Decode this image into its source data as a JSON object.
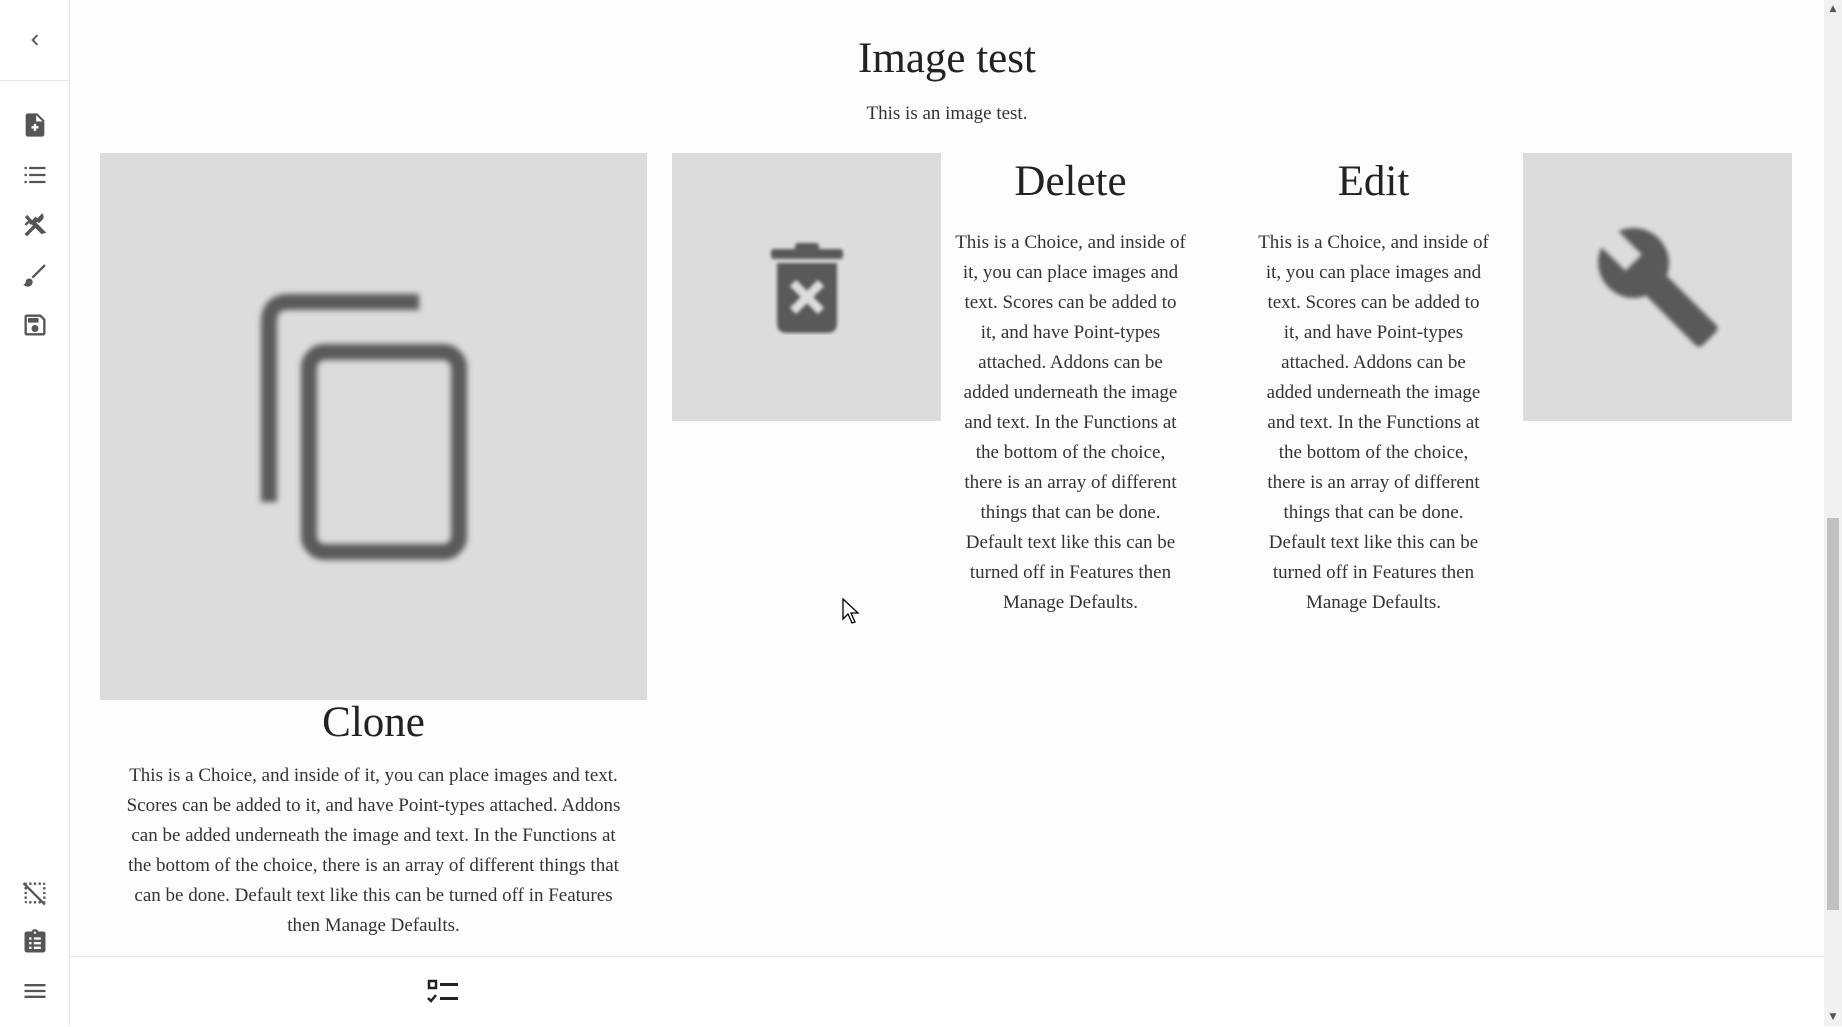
{
  "page": {
    "title": "Image test",
    "subtitle": "This is an image test."
  },
  "sidebar": {
    "top": [
      {
        "icon": "back-chevron-icon"
      },
      {
        "icon": "new-file-icon"
      },
      {
        "icon": "list-icon"
      },
      {
        "icon": "tools-icon"
      },
      {
        "icon": "brush-icon"
      },
      {
        "icon": "save-icon"
      }
    ],
    "bottom": [
      {
        "icon": "selection-off-icon"
      },
      {
        "icon": "clipboard-icon"
      },
      {
        "icon": "menu-icon"
      }
    ]
  },
  "choices": [
    {
      "title": "Clone",
      "icon": "copy-icon",
      "text_lines": [
        "This is a Choice, and inside of it, you can place images and text.",
        "Scores can be added to it, and have Point-types attached. Addons",
        "can be added underneath the image and text. In the Functions at",
        "the bottom of the choice, there is an array of different things that",
        "can be done. Default text like this can be turned off in Features",
        "then Manage Defaults."
      ]
    },
    {
      "title": "Delete",
      "icon": "delete-forever-icon",
      "text_lines": [
        "This is a Choice, and inside of",
        "it, you can place images and",
        "text. Scores can be added to",
        "it, and have Point-types",
        "attached. Addons can be",
        "added underneath the image",
        "and text. In the Functions at",
        "the bottom of the choice,",
        "there is an array of different",
        "things that can be done.",
        "Default text like this can be",
        "turned off in Features then",
        "Manage Defaults."
      ]
    },
    {
      "title": "Edit",
      "icon": "wrench-icon",
      "text_lines": [
        "This is a Choice, and inside of",
        "it, you can place images and",
        "text. Scores can be added to",
        "it, and have Point-types",
        "attached. Addons can be",
        "added underneath the image",
        "and text. In the Functions at",
        "the bottom of the choice,",
        "there is an array of different",
        "things that can be done.",
        "Default text like this can be",
        "turned off in Features then",
        "Manage Defaults."
      ]
    }
  ],
  "bottombar": {
    "icon": "checklist-icon"
  }
}
